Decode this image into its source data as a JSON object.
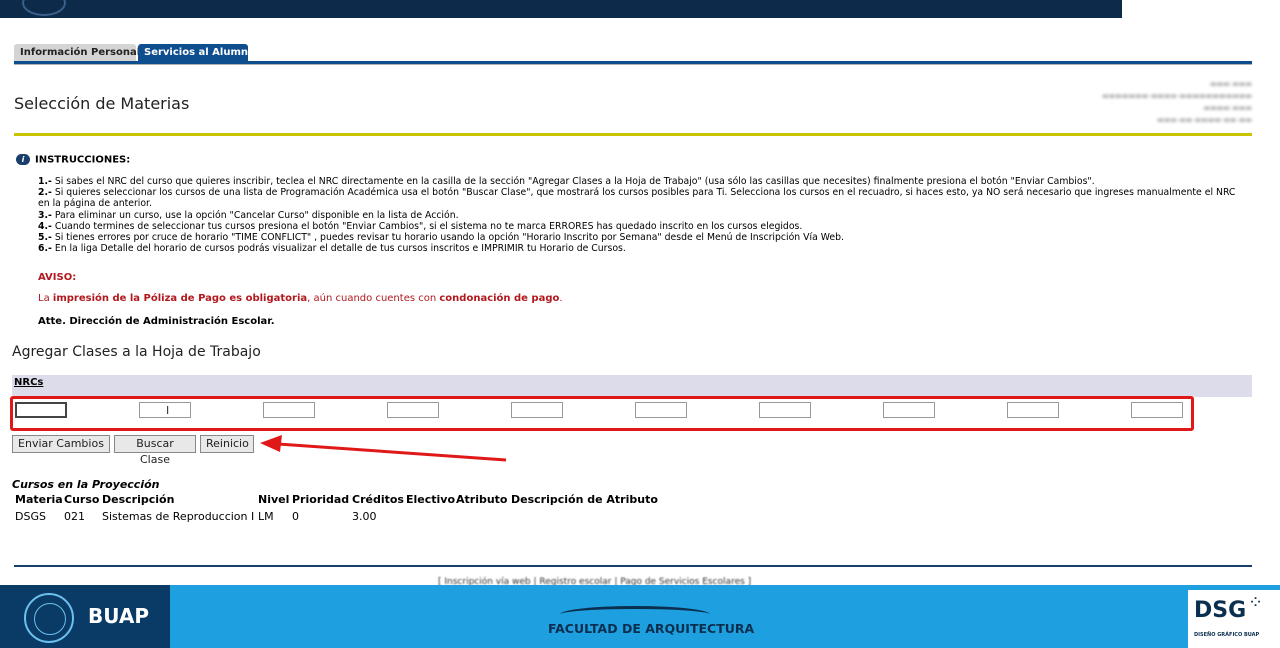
{
  "tabs": {
    "personal": "Información Personal",
    "services": "Servicios al Alumno"
  },
  "page_title": "Selección de Materias",
  "instructions": {
    "header": "INSTRUCCIONES:",
    "items": [
      {
        "n": "1.-",
        "text": "Si sabes el NRC del curso que quieres inscribir, teclea el NRC directamente en la casilla de la sección \"Agregar Clases a la Hoja de Trabajo\" (usa sólo las casillas que necesites) finalmente presiona el botón \"Enviar Cambios\"."
      },
      {
        "n": "2.-",
        "text": "Si quieres seleccionar los cursos de una lista de Programación Académica usa el botón \"Buscar Clase\", que mostrará los cursos posibles para Ti. Selecciona los cursos en el recuadro, si haces esto, ya NO será necesario que ingreses manualmente el NRC en la página de anterior."
      },
      {
        "n": "3.-",
        "text": "Para eliminar un curso, use la opción \"Cancelar Curso\" disponible en la lista de Acción."
      },
      {
        "n": "4.-",
        "text": "Cuando termines de seleccionar tus cursos presiona el botón \"Enviar Cambios\", si el sistema no te marca ERRORES has quedado inscrito en los cursos elegidos."
      },
      {
        "n": "5.-",
        "text": "Si tienes errores por cruce de horario \"TIME CONFLICT\" , puedes revisar tu horario usando la opción \"Horario Inscrito por Semana\" desde el Menú de Inscripción Vía Web."
      },
      {
        "n": "6.-",
        "text": "En la liga Detalle del horario de cursos podrás visualizar el detalle de tus cursos inscritos e IMPRIMIR tu Horario de Cursos."
      }
    ]
  },
  "aviso": {
    "label": "AVISO:",
    "t1": "La ",
    "b1": "impresión de la Póliza de Pago es obligatoria",
    "t2": ", aún cuando cuentes con ",
    "b2": "condonación de pago",
    "t3": "."
  },
  "signature": "Atte. Dirección de Administración Escolar.",
  "add_classes": {
    "title": "Agregar Clases a la Hoja de Trabajo",
    "nrc_label": "NRCs"
  },
  "buttons": {
    "submit": "Enviar Cambios",
    "search": "Buscar Clase",
    "reset": "Reinicio"
  },
  "courses": {
    "title": "Cursos en la Proyección",
    "headers": [
      "Materia",
      "Curso",
      "Descripción",
      "Nivel",
      "Prioridad",
      "Créditos",
      "Electivo",
      "Atributo",
      "Descripción de Atributo"
    ],
    "rows": [
      [
        "DSGS",
        "021",
        "Sistemas de Reproduccion I",
        "LM",
        "0",
        "3.00",
        "",
        "",
        ""
      ]
    ]
  },
  "footer": {
    "links": "[ Inscripción vía web | Registro escolar | Pago de Servicios Escolares ]",
    "brand": "BUAP",
    "faculty": "FACULTAD DE ARQUITECTURA",
    "dsg": "DSG",
    "dsg_sub": "DISEÑO GRÁFICO BUAP"
  },
  "colors": {
    "accent": "#0e4d8e",
    "rule": "#c9c300",
    "alert": "#b2191e",
    "highlight_box": "#e01818",
    "footer": "#1e9fe0"
  }
}
